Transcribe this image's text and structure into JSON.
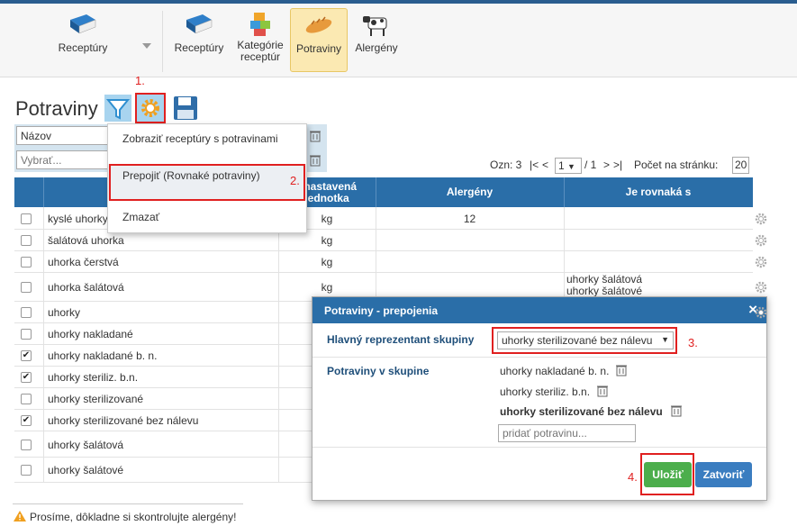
{
  "toolbar": {
    "group_label": "Receptúry",
    "items": [
      {
        "label": "Receptúry",
        "icon": "book-icon"
      },
      {
        "label": "Kategórie\nreceptúr",
        "icon": "boxes-icon"
      },
      {
        "label": "Potraviny",
        "icon": "bread-icon",
        "active": true
      },
      {
        "label": "Alergény",
        "icon": "cow-icon"
      }
    ]
  },
  "page": {
    "title": "Potraviny"
  },
  "filter": {
    "select_value": "Názov",
    "input_placeholder": "Vybrať..."
  },
  "menu": {
    "items": [
      "Zobraziť receptúry s potravinami",
      "Prepojiť (Rovnaké potraviny)",
      "Zmazať"
    ]
  },
  "pagination": {
    "selected_label": "Ozn: 3",
    "nav_first": "|<",
    "nav_prev": "<",
    "page": "1",
    "total": "/ 1",
    "nav_next": ">",
    "nav_last": ">|",
    "per_page_label": "Počet na stránku:",
    "per_page": "20"
  },
  "table": {
    "headers": {
      "unit": "dnastavená\njednotka",
      "allergens": "Alergény",
      "same_as": "Je rovnaká s"
    },
    "rows": [
      {
        "name": "kyslé uhorky",
        "unit": "kg",
        "allergens": "12",
        "same": "",
        "checked": false
      },
      {
        "name": "šalátová uhorka",
        "unit": "kg",
        "allergens": "",
        "same": "",
        "checked": false
      },
      {
        "name": "uhorka čerstvá",
        "unit": "kg",
        "allergens": "",
        "same": "",
        "checked": false
      },
      {
        "name": "uhorka šalátová",
        "unit": "kg",
        "allergens": "",
        "same": "uhorky šalátová\nuhorky šalátové",
        "checked": false
      },
      {
        "name": "uhorky",
        "unit": "",
        "allergens": "",
        "same": "",
        "checked": false
      },
      {
        "name": "uhorky nakladané",
        "unit": "",
        "allergens": "",
        "same": "",
        "checked": false
      },
      {
        "name": "uhorky nakladané b. n.",
        "unit": "",
        "allergens": "",
        "same": "",
        "checked": true
      },
      {
        "name": "uhorky steriliz. b.n.",
        "unit": "",
        "allergens": "",
        "same": "",
        "checked": true
      },
      {
        "name": "uhorky sterilizované",
        "unit": "",
        "allergens": "",
        "same": "",
        "checked": false
      },
      {
        "name": "uhorky sterilizované bez nálevu",
        "unit": "",
        "allergens": "",
        "same": "",
        "checked": true
      },
      {
        "name": "uhorky šalátová",
        "unit": "",
        "allergens": "",
        "same": "",
        "checked": false
      },
      {
        "name": "uhorky šalátové",
        "unit": "",
        "allergens": "",
        "same": "",
        "checked": false
      }
    ]
  },
  "dialog": {
    "title": "Potraviny - prepojenia",
    "main_label": "Hlavný reprezentant skupiny",
    "main_value": "uhorky sterilizované bez nálevu",
    "group_label": "Potraviny v skupine",
    "group_items": [
      "uhorky nakladané b. n.",
      "uhorky steriliz. b.n.",
      "uhorky sterilizované bez nálevu"
    ],
    "add_placeholder": "pridať potravinu...",
    "save": "Uložiť",
    "close": "Zatvoriť",
    "close_x": "×"
  },
  "annotations": {
    "a1": "1.",
    "a2": "2.",
    "a3": "3.",
    "a4": "4."
  },
  "footer": {
    "warning": "Prosíme, dôkladne si skontrolujte alergény!"
  },
  "colors": {
    "header_blue": "#2a6ea8",
    "accent_red": "#e02020",
    "save_green": "#4cae4c",
    "close_blue": "#3a7dc0"
  }
}
